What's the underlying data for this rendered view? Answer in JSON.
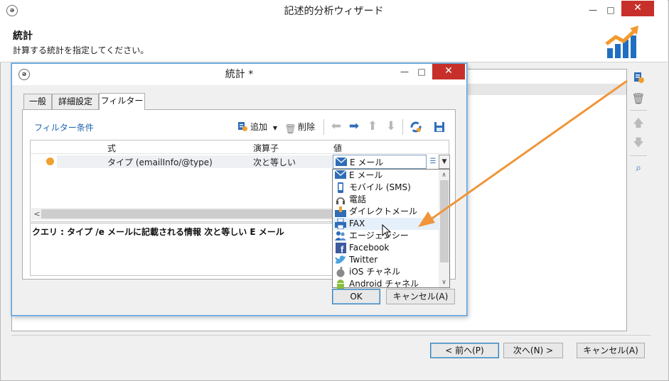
{
  "outer_window": {
    "title": "記述的分析ウィザード",
    "minimize_glyph": "—",
    "maximize_glyph": "□",
    "close_glyph": "✕"
  },
  "header": {
    "title": "統計",
    "description": "計算する統計を指定してください。"
  },
  "right_toolbar": {
    "icons": [
      "add-statistic-icon",
      "delete-icon",
      "move-up-icon",
      "move-down-icon",
      "search-icon"
    ]
  },
  "footer": {
    "prev_label": "< 前へ(P)",
    "next_label": "次へ(N) >",
    "cancel_label": "キャンセル(A)"
  },
  "inner_dialog": {
    "title": "統計 *",
    "minimize_glyph": "—",
    "maximize_glyph": "□",
    "close_glyph": "✕",
    "tabs": [
      {
        "label": "一般"
      },
      {
        "label": "詳細設定"
      },
      {
        "label": "フィルター",
        "active": true
      }
    ],
    "filter_section_label": "フィルター条件",
    "toolbar": {
      "add_label": "追加",
      "delete_label": "削除"
    },
    "grid": {
      "columns": [
        "式",
        "演算子",
        "値"
      ],
      "row": {
        "expression": "タイプ (emailInfo/@type)",
        "operator": "次と等しい",
        "value": "E メール"
      }
    },
    "query_text": "クエリ : タイプ /e メールに記載される情報 次と等しい E メール",
    "dropdown_items": [
      {
        "label": "E メール",
        "icon": "email-icon"
      },
      {
        "label": "モバイル (SMS)",
        "icon": "mobile-icon"
      },
      {
        "label": "電話",
        "icon": "headset-icon"
      },
      {
        "label": "ダイレクトメール",
        "icon": "direct-mail-icon"
      },
      {
        "label": "FAX",
        "icon": "fax-icon",
        "hovered": true
      },
      {
        "label": "エージェンシー",
        "icon": "agency-icon"
      },
      {
        "label": "Facebook",
        "icon": "facebook-icon"
      },
      {
        "label": "Twitter",
        "icon": "twitter-icon"
      },
      {
        "label": "iOS チャネル",
        "icon": "apple-icon"
      },
      {
        "label": "Android チャネル",
        "icon": "android-icon"
      }
    ],
    "ok_label": "OK",
    "cancel_label": "キャンセル(A)"
  },
  "colors": {
    "close_red": "#c7302a",
    "accent_blue": "#1c62b0",
    "arrow_orange": "#f0953a",
    "status_orange": "#f0a030"
  }
}
